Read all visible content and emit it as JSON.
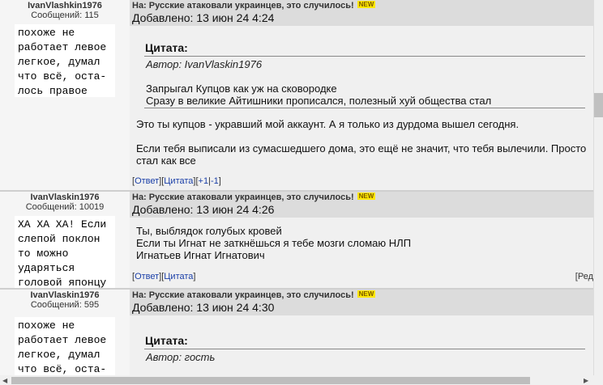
{
  "topic_badge": "NEW",
  "posts": [
    {
      "username": "IvanVlashkin1976",
      "count_label": "Сообщений: 115",
      "status": "похоже не\nработает левое\nлегкое, думал\nчто всё, оста-\nлось правое",
      "topic": "На: Русские атаковали украинцев, это случилось!",
      "date": "Добавлено: 13 июн 24 4:24",
      "quote_title": "Цитата:",
      "quote_author": "Автор: IvanVlaskin1976",
      "quote_text": "Запрыгал Купцов как уж на сковородке\nСразу в великие Айтишники прописался, полезный хуй общества стал",
      "body": "Это ты купцов - укравший мой аккаунт. А я только из дурдома вышел сегодня.\n\nЕсли тебя выписали из сумасшедшего дома, это ещё не значит, что тебя вылечили. Просто\nстал как все",
      "links": {
        "open": "[",
        "reply": "Ответ",
        "mid": "][",
        "quote": "Цитата",
        "mid2": "][",
        "plus": "+1",
        "bar": "|",
        "minus": "-1",
        "close": "]"
      }
    },
    {
      "username": "IvanVlaskin1976",
      "count_label": "Сообщений: 10019",
      "status": "ХА ХА ХА! Если\nслепой поклон\nто можно\nударяться\nголовой японцу",
      "topic": "На: Русские атаковали украинцев, это случилось!",
      "date": "Добавлено: 13 июн 24 4:26",
      "body": "Ты, выблядок голубых кровей\nЕсли ты Игнат не заткнёшься я тебе мозги сломаю НЛП\nИгнатьев Игнат Игнатович",
      "links": {
        "open": "[",
        "reply": "Ответ",
        "mid": "][",
        "quote": "Цитата",
        "close": "]"
      },
      "edit": "[Ред"
    },
    {
      "username": "IvanVlaskin1976",
      "count_label": "Сообщений: 595",
      "status": "похоже не\nработает левое\nлегкое, думал\nчто всё, оста-\nлось правое",
      "topic": "На: Русские атаковали украинцев, это случилось!",
      "date": "Добавлено: 13 июн 24 4:30",
      "quote_title": "Цитата:",
      "quote_author": "Автор: гость"
    }
  ]
}
